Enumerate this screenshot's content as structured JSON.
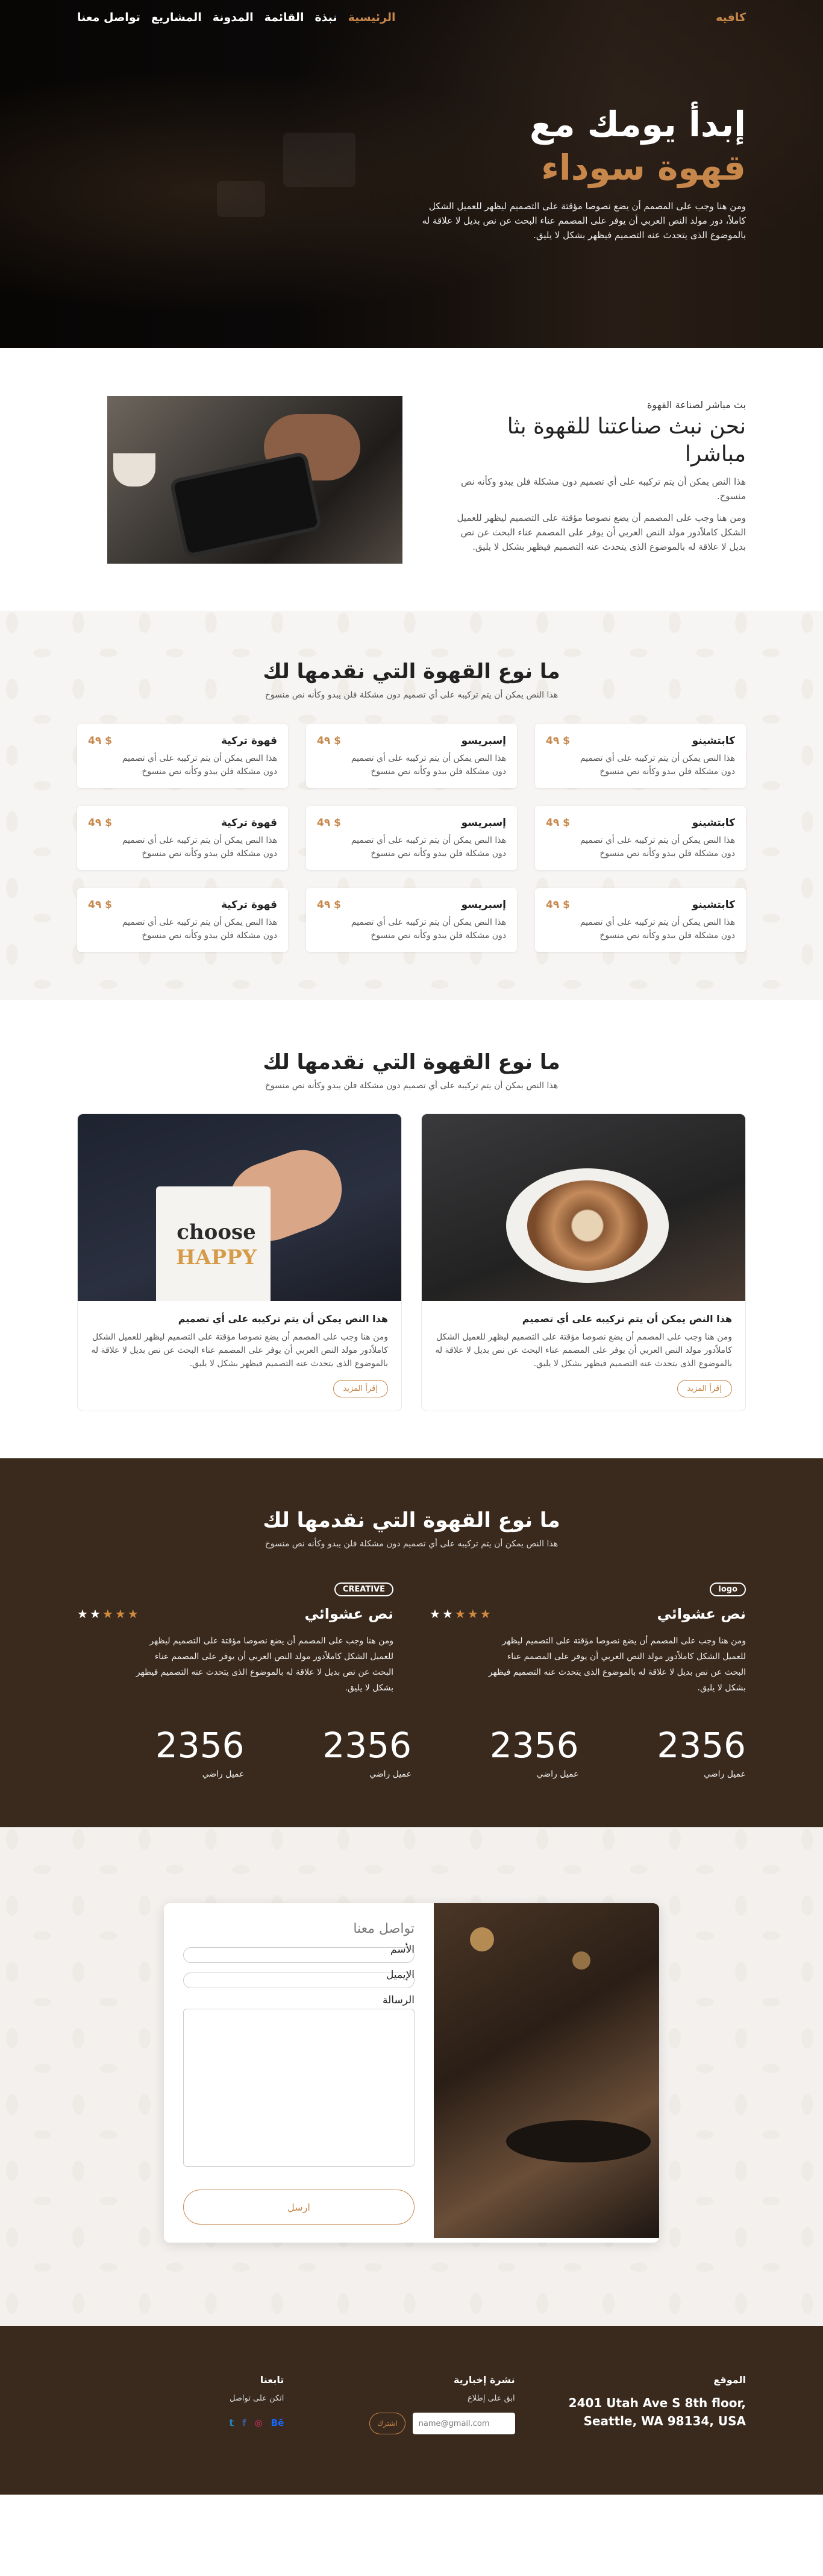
{
  "nav": {
    "brand": "كافيه",
    "items": [
      "الرئيسية",
      "نبذة",
      "القائمة",
      "المدونة",
      "المشاريع",
      "تواصل معنا"
    ],
    "active_index": 0
  },
  "hero": {
    "title_line1": "إبدأ يومك مع",
    "title_line2": "قهوة سوداء",
    "text": "ومن هنا وجب على المصمم أن يضع نصوصا مؤقتة على التصميم ليظهر للعميل الشكل كاملاً، دور مولد النص العربي أن يوفر على المصمم عناء البحث عن نص بديل لا علاقة له بالموضوع الذى يتحدث عنه التصميم فيظهر بشكل لا يليق."
  },
  "about": {
    "kicker": "بث مباشر لصناعة القهوة",
    "title": "نحن نبث صناعتنا للقهوة بثا مباشرا",
    "p1": "هذا النص يمكن أن يتم تركيبه على أي تصميم دون مشكلة فلن يبدو وكأنه نص منسوخ.",
    "p2": "ومن هنا وجب على المصمم أن يضع نصوصا مؤقتة على التصميم ليظهر للعميل الشكل كاملاًدور مولد النص العربي أن يوفر على المصمم عناء البحث عن نص بديل لا علاقة له بالموضوع الذى يتحدث عنه التصميم فيظهر بشكل لا يليق."
  },
  "types": {
    "title": "ما نوع القهوة التي نقدمها لك",
    "subtitle": "هذا النص يمكن أن يتم تركيبه على أي تصميم دون مشكلة فلن يبدو وكأنه نص منسوخ",
    "items": [
      {
        "name": "كابتشينو",
        "price": "4٩ $",
        "desc": "هذا النص يمكن أن يتم تركيبه على أي تصميم دون مشكلة فلن يبدو وكأنه نص منسوخ"
      },
      {
        "name": "إسبريسو",
        "price": "4٩ $",
        "desc": "هذا النص يمكن أن يتم تركيبه على أي تصميم دون مشكلة فلن يبدو وكأنه نص منسوخ"
      },
      {
        "name": "قهوة تركية",
        "price": "4٩ $",
        "desc": "هذا النص يمكن أن يتم تركيبه على أي تصميم دون مشكلة فلن يبدو وكأنه نص منسوخ"
      },
      {
        "name": "كابتشينو",
        "price": "4٩ $",
        "desc": "هذا النص يمكن أن يتم تركيبه على أي تصميم دون مشكلة فلن يبدو وكأنه نص منسوخ"
      },
      {
        "name": "إسبريسو",
        "price": "4٩ $",
        "desc": "هذا النص يمكن أن يتم تركيبه على أي تصميم دون مشكلة فلن يبدو وكأنه نص منسوخ"
      },
      {
        "name": "قهوة تركية",
        "price": "4٩ $",
        "desc": "هذا النص يمكن أن يتم تركيبه على أي تصميم دون مشكلة فلن يبدو وكأنه نص منسوخ"
      },
      {
        "name": "كابتشينو",
        "price": "4٩ $",
        "desc": "هذا النص يمكن أن يتم تركيبه على أي تصميم دون مشكلة فلن يبدو وكأنه نص منسوخ"
      },
      {
        "name": "إسبريسو",
        "price": "4٩ $",
        "desc": "هذا النص يمكن أن يتم تركيبه على أي تصميم دون مشكلة فلن يبدو وكأنه نص منسوخ"
      },
      {
        "name": "قهوة تركية",
        "price": "4٩ $",
        "desc": "هذا النص يمكن أن يتم تركيبه على أي تصميم دون مشكلة فلن يبدو وكأنه نص منسوخ"
      }
    ]
  },
  "blog": {
    "title": "ما نوع القهوة التي نقدمها لك",
    "subtitle": "هذا النص يمكن أن يتم تركيبه على أي تصميم دون مشكلة فلن يبدو وكأنه نص منسوخ",
    "posts": [
      {
        "title": "هذا النص يمكن أن يتم تركيبه على أي تصميم",
        "text": "ومن هنا وجب على المصمم أن يضع نصوصا مؤقتة على التصميم ليظهر للعميل الشكل كاملاًدور مولد النص العربي أن يوفر على المصمم عناء البحث عن نص بديل لا علاقة له بالموضوع الذى يتحدث عنه التصميم فيظهر بشكل لا يليق.",
        "button": "إقرأ المزيد"
      },
      {
        "title": "هذا النص يمكن أن يتم تركيبه على أي تصميم",
        "text": "ومن هنا وجب على المصمم أن يضع نصوصا مؤقتة على التصميم ليظهر للعميل الشكل كاملاًدور مولد النص العربي أن يوفر على المصمم عناء البحث عن نص بديل لا علاقة له بالموضوع الذى يتحدث عنه التصميم فيظهر بشكل لا يليق.",
        "button": "إقرأ المزيد",
        "mug_word1": "choose",
        "mug_word2": "HAPPY"
      }
    ]
  },
  "testimonials": {
    "title": "ما نوع القهوة التي نقدمها لك",
    "subtitle": "هذا النص يمكن أن يتم تركيبه على أي تصميم دون مشكلة فلن يبدو وكأنه نص منسوخ",
    "items": [
      {
        "logo": "logo",
        "name": "نص عشوائي",
        "rating": 3,
        "max": 5,
        "text": "ومن هنا وجب على المصمم أن يضع نصوصا مؤقتة على التصميم ليظهر للعميل الشكل كاملاًدور مولد النص العربي أن يوفر على المصمم عناء البحث عن نص بديل لا علاقة له بالموضوع الذى يتحدث عنه التصميم فيظهر بشكل لا يليق."
      },
      {
        "logo": "CREATIVE",
        "name": "نص عشوائي",
        "rating": 3,
        "max": 5,
        "text": "ومن هنا وجب على المصمم أن يضع نصوصا مؤقتة على التصميم ليظهر للعميل الشكل كاملاًدور مولد النص العربي أن يوفر على المصمم عناء البحث عن نص بديل لا علاقة له بالموضوع الذى يتحدث عنه التصميم فيظهر بشكل لا يليق."
      }
    ],
    "stats": [
      {
        "num": "2356",
        "label": "عميل راضي"
      },
      {
        "num": "2356",
        "label": "عميل راضي"
      },
      {
        "num": "2356",
        "label": "عميل راضي"
      },
      {
        "num": "2356",
        "label": "عميل راضي"
      }
    ]
  },
  "contact": {
    "title": "تواصل معنا",
    "name_label": "الأسم",
    "email_label": "الإيميل",
    "message_label": "الرسالة",
    "submit": "ارسل"
  },
  "footer": {
    "location_title": "الموقع",
    "address": "2401 Utah Ave S 8th floor, Seattle, WA 98134, USA",
    "newsletter_title": "نشرة إخبارية",
    "newsletter_text": "ابق على إطلاع",
    "email_placeholder": "name@gmail.com",
    "subscribe": "اشترك",
    "follow_title": "تابعنا",
    "follow_text": "اتكن على تواصل",
    "social": [
      "twitter-icon",
      "facebook-icon",
      "instagram-icon",
      "behance-icon"
    ]
  },
  "colors": {
    "accent": "#c7874a",
    "dark": "#3a2a1d"
  }
}
